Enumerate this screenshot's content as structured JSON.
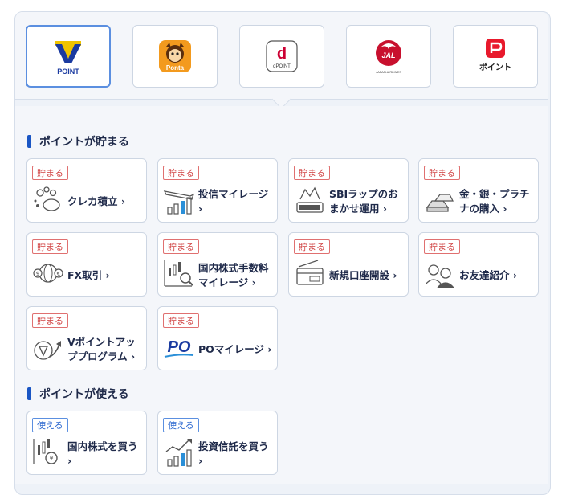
{
  "tabs": [
    {
      "label": "POINT",
      "selected": true
    },
    {
      "label": "Ponta",
      "selected": false
    },
    {
      "label": "dPOINT",
      "selected": false
    },
    {
      "label": "JAL",
      "sublabel": "JAPAN AIRLINES",
      "selected": false
    },
    {
      "label": "ポイント",
      "selected": false
    }
  ],
  "sections": {
    "earn": {
      "title": "ポイントが貯まる",
      "badge": "貯まる",
      "cards": [
        {
          "label": "クレカ積立 ›",
          "icon": "coins-piggy-icon"
        },
        {
          "label": "投信マイレージ ›",
          "icon": "airplane-chart-icon"
        },
        {
          "label": "SBIラップのおまかせ運用 ›",
          "icon": "sbi-wrap-icon"
        },
        {
          "label": "金・銀・プラチナの購入 ›",
          "icon": "gold-bars-icon"
        },
        {
          "label": "FX取引 ›",
          "icon": "currency-globe-icon"
        },
        {
          "label": "国内株式手数料マイレージ ›",
          "icon": "candlestick-magnifier-icon"
        },
        {
          "label": "新規口座開設 ›",
          "icon": "bank-card-icon"
        },
        {
          "label": "お友達紹介 ›",
          "icon": "friends-icon"
        },
        {
          "label": "Vポイントアッププログラム ›",
          "icon": "v-point-up-icon"
        },
        {
          "label": "POマイレージ ›",
          "icon": "po-mileage-icon"
        }
      ]
    },
    "use": {
      "title": "ポイントが使える",
      "badge": "使える",
      "cards": [
        {
          "label": "国内株式を買う ›",
          "icon": "stock-yen-icon"
        },
        {
          "label": "投資信託を買う ›",
          "icon": "fund-chart-icon"
        }
      ]
    }
  },
  "colors": {
    "accent": "#1a56c4",
    "earn_badge": "#d04040",
    "use_badge": "#2f6ad0",
    "v_yellow": "#f0c400",
    "v_blue": "#1a3aa0",
    "ponta_orange": "#f39a1e",
    "d_red": "#cc0033",
    "jal_red": "#c8102e",
    "paypay_red": "#e8192c"
  }
}
